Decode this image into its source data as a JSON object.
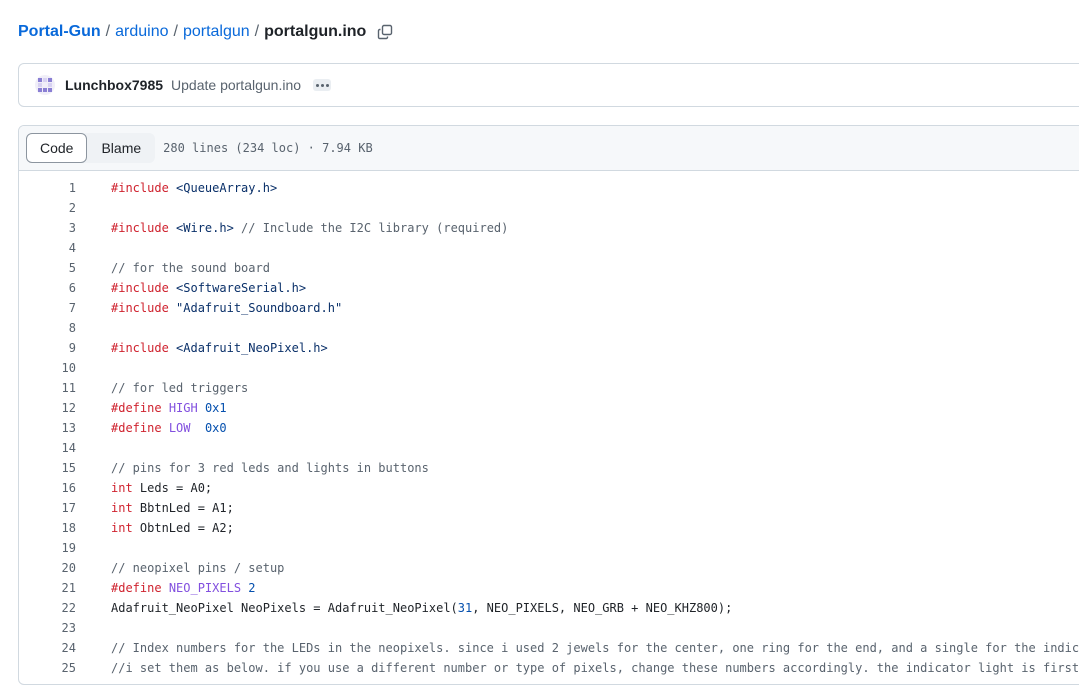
{
  "breadcrumb": {
    "repo": "Portal-Gun",
    "sep": "/",
    "dir1": "arduino",
    "dir2": "portalgun",
    "file": "portalgun.ino"
  },
  "commit": {
    "author": "Lunchbox7985",
    "message": "Update portalgun.ino"
  },
  "file_header": {
    "code_label": "Code",
    "blame_label": "Blame",
    "info": "280 lines (234 loc) · 7.94 KB"
  },
  "colors": {
    "link": "#0969da",
    "keyword": "#cf222e",
    "string": "#0a3069",
    "comment": "#59636e",
    "number": "#0550ae",
    "constant": "#8250df"
  },
  "code_lines": [
    {
      "n": "1",
      "tokens": [
        {
          "t": "kw",
          "v": "#include"
        },
        {
          "t": "str",
          "v": " <QueueArray.h>"
        }
      ]
    },
    {
      "n": "2",
      "tokens": []
    },
    {
      "n": "3",
      "tokens": [
        {
          "t": "kw",
          "v": "#include"
        },
        {
          "t": "str",
          "v": " <Wire.h>"
        },
        {
          "t": "cm",
          "v": " // Include the I2C library (required)"
        }
      ]
    },
    {
      "n": "4",
      "tokens": []
    },
    {
      "n": "5",
      "tokens": [
        {
          "t": "cm",
          "v": "// for the sound board"
        }
      ]
    },
    {
      "n": "6",
      "tokens": [
        {
          "t": "kw",
          "v": "#include"
        },
        {
          "t": "str",
          "v": " <SoftwareSerial.h>"
        }
      ]
    },
    {
      "n": "7",
      "tokens": [
        {
          "t": "kw",
          "v": "#include"
        },
        {
          "t": "str",
          "v": " \"Adafruit_Soundboard.h\""
        }
      ]
    },
    {
      "n": "8",
      "tokens": []
    },
    {
      "n": "9",
      "tokens": [
        {
          "t": "kw",
          "v": "#include"
        },
        {
          "t": "str",
          "v": " <Adafruit_NeoPixel.h>"
        }
      ]
    },
    {
      "n": "10",
      "tokens": []
    },
    {
      "n": "11",
      "tokens": [
        {
          "t": "cm",
          "v": "// for led triggers"
        }
      ]
    },
    {
      "n": "12",
      "tokens": [
        {
          "t": "kw",
          "v": "#define"
        },
        {
          "t": "p",
          "v": " "
        },
        {
          "t": "ent",
          "v": "HIGH"
        },
        {
          "t": "p",
          "v": " "
        },
        {
          "t": "num",
          "v": "0x1"
        }
      ]
    },
    {
      "n": "13",
      "tokens": [
        {
          "t": "kw",
          "v": "#define"
        },
        {
          "t": "p",
          "v": " "
        },
        {
          "t": "ent",
          "v": "LOW"
        },
        {
          "t": "p",
          "v": "  "
        },
        {
          "t": "num",
          "v": "0x0"
        }
      ]
    },
    {
      "n": "14",
      "tokens": []
    },
    {
      "n": "15",
      "tokens": [
        {
          "t": "cm",
          "v": "// pins for 3 red leds and lights in buttons"
        }
      ]
    },
    {
      "n": "16",
      "tokens": [
        {
          "t": "kw",
          "v": "int"
        },
        {
          "t": "p",
          "v": " Leds = A0;"
        }
      ]
    },
    {
      "n": "17",
      "tokens": [
        {
          "t": "kw",
          "v": "int"
        },
        {
          "t": "p",
          "v": " BbtnLed = A1;"
        }
      ]
    },
    {
      "n": "18",
      "tokens": [
        {
          "t": "kw",
          "v": "int"
        },
        {
          "t": "p",
          "v": " ObtnLed = A2;"
        }
      ]
    },
    {
      "n": "19",
      "tokens": []
    },
    {
      "n": "20",
      "tokens": [
        {
          "t": "cm",
          "v": "// neopixel pins / setup"
        }
      ]
    },
    {
      "n": "21",
      "tokens": [
        {
          "t": "kw",
          "v": "#define"
        },
        {
          "t": "p",
          "v": " "
        },
        {
          "t": "ent",
          "v": "NEO_PIXELS"
        },
        {
          "t": "p",
          "v": " "
        },
        {
          "t": "num",
          "v": "2"
        }
      ]
    },
    {
      "n": "22",
      "tokens": [
        {
          "t": "p",
          "v": "Adafruit_NeoPixel NeoPixels = Adafruit_NeoPixel("
        },
        {
          "t": "num",
          "v": "31"
        },
        {
          "t": "p",
          "v": ", NEO_PIXELS, NEO_GRB + NEO_KHZ800);"
        }
      ]
    },
    {
      "n": "23",
      "tokens": []
    },
    {
      "n": "24",
      "tokens": [
        {
          "t": "cm",
          "v": "// Index numbers for the LEDs in the neopixels. since i used 2 jewels for the center, one ring for the end, and a single for the indic"
        }
      ]
    },
    {
      "n": "25",
      "tokens": [
        {
          "t": "cm",
          "v": "//i set them as below. if you use a different number or type of pixels, change these numbers accordingly. the indicator light is first"
        }
      ]
    }
  ]
}
